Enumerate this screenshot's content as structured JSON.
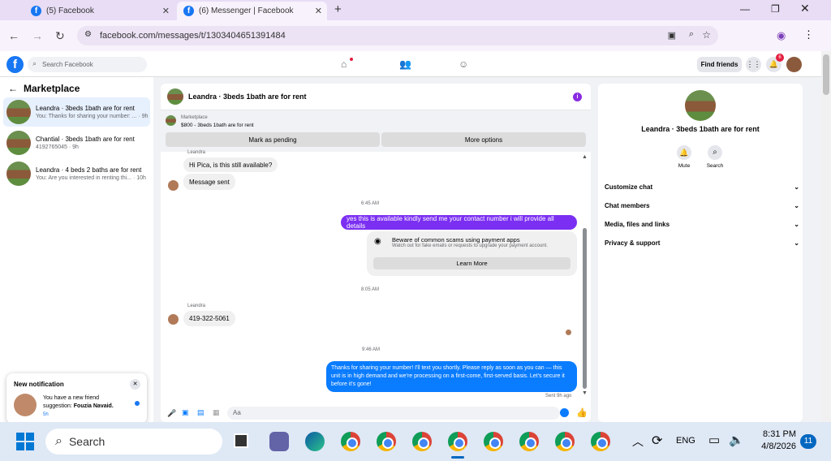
{
  "browser": {
    "tabs": [
      {
        "label": "(5) Facebook"
      },
      {
        "label": "(6) Messenger | Facebook"
      }
    ],
    "url": "facebook.com/messages/t/1303404651391484"
  },
  "fb": {
    "search_placeholder": "Search Facebook",
    "find_friends": "Find friends",
    "notif_count": "6"
  },
  "marketplace": {
    "title": "Marketplace",
    "conversations": [
      {
        "title": "Leandra · 3beds 1bath are for rent",
        "sub": "You: Thanks for sharing your number: ... · 9h"
      },
      {
        "title": "Chantial · 3beds 1bath are for rent",
        "sub": "4192765045 · 9h"
      },
      {
        "title": "Leandra · 4 beds 2 baths are for rent",
        "sub": "You: Are you interested in renting thi... · 10h"
      }
    ]
  },
  "notification": {
    "header": "New notification",
    "text_prefix": "You have a new friend suggestion:",
    "name": "Fouzia Navaid.",
    "time": "5h"
  },
  "chat": {
    "header": "Leandra · 3beds 1bath are for rent",
    "listing_label": "Marketplace",
    "listing": "$800 - 3beds 1bath are for rent",
    "mark_pending": "Mark as pending",
    "more_options": "More options",
    "sender_top": "Leandra",
    "msg1": "Hi Pica, is this still available?",
    "msg2": "Message sent",
    "time1": "6:45 AM",
    "msg3": "yes this is available kindly send me your contact number i will provide all  details",
    "scam_title": "Beware of common scams using payment apps",
    "scam_sub": "Watch out for fake emails or requests to upgrade your payment account.",
    "learn_more": "Learn More",
    "time2": "8:05 AM",
    "sender2": "Leandra",
    "msg4": "419-322-5061",
    "time3": "9:46 AM",
    "msg5": "Thanks for sharing your number! I'll text you shortly. Please reply as soon as you can — this unit is in high demand and we're processing on a first-come, first-served basis. Let's secure it before it's gone!",
    "sent_status": "Sent 9h ago",
    "input_placeholder": "Aa"
  },
  "info": {
    "title": "Leandra · 3beds 1bath are for rent",
    "mute": "Mute",
    "search": "Search",
    "sections": [
      "Customize chat",
      "Chat members",
      "Media, files and links",
      "Privacy & support"
    ]
  },
  "taskbar": {
    "search": "Search",
    "lang": "ENG",
    "time": "8:31 PM",
    "date": "4/8/2026",
    "badge": "11"
  }
}
